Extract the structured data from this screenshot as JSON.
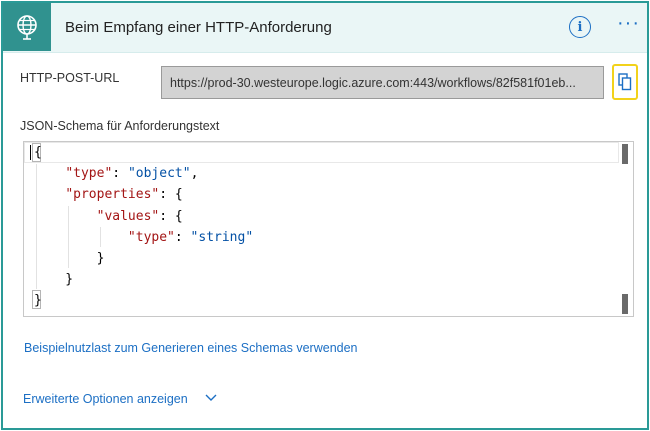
{
  "header": {
    "title": "Beim Empfang einer HTTP-Anforderung",
    "trigger_icon": "globe-request-icon",
    "info_icon": "info-icon",
    "info_glyph": "i",
    "more_icon": "ellipsis-icon",
    "more_glyph": "···",
    "accent": "#30928f",
    "border": "#2a9a97"
  },
  "url": {
    "label": "HTTP-POST-URL",
    "value": "https://prod-30.westeurope.logic.azure.com:443/workflows/82f581f01eb...",
    "copy_icon": "copy-icon",
    "highlight": "#f2d21b"
  },
  "schema": {
    "label": "JSON-Schema für Anforderungstext",
    "lines": [
      {
        "t0": "{"
      },
      {
        "t0": "    ",
        "k1": "\"type\"",
        "t2": ": ",
        "s3": "\"object\"",
        "t4": ","
      },
      {
        "t0": "    ",
        "k1": "\"properties\"",
        "t2": ": {"
      },
      {
        "t0": "        ",
        "k1": "\"values\"",
        "t2": ": {"
      },
      {
        "t0": "            ",
        "k1": "\"type\"",
        "t2": ": ",
        "s3": "\"string\""
      },
      {
        "t0": "        }"
      },
      {
        "t0": "    }"
      },
      {
        "t0": "}"
      }
    ]
  },
  "links": {
    "sample_payload": "Beispielnutzlast zum Generieren eines Schemas verwenden",
    "advanced_options": "Erweiterte Optionen anzeigen",
    "chevron_icon": "chevron-down-icon"
  }
}
